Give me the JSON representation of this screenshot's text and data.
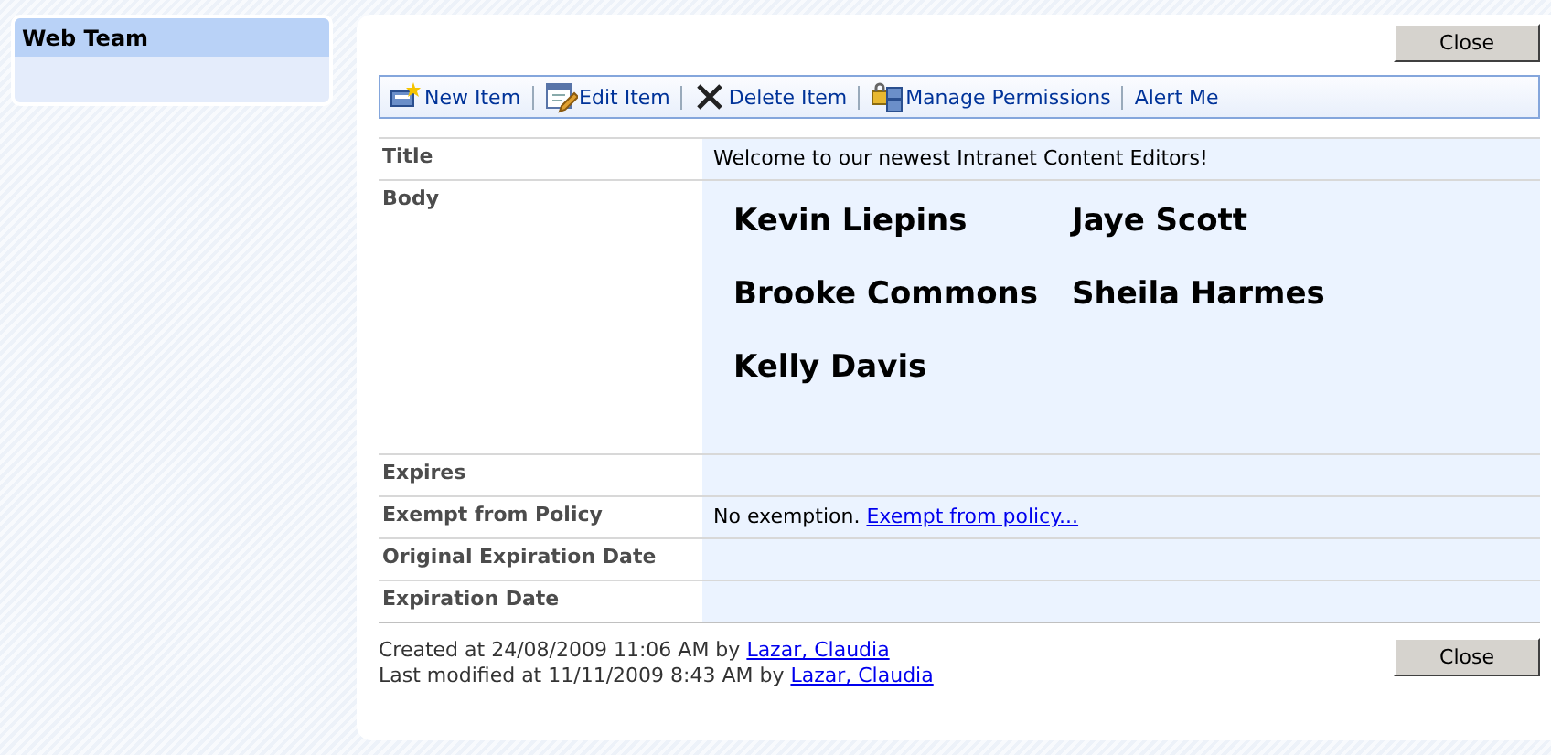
{
  "sidebar": {
    "title": "Web Team"
  },
  "close_buttons": [
    "Close",
    "Close"
  ],
  "toolbar": [
    {
      "kind": "new",
      "label": "New Item"
    },
    {
      "kind": "edit",
      "label": "Edit Item"
    },
    {
      "kind": "delete",
      "label": "Delete Item"
    },
    {
      "kind": "permissions",
      "label": "Manage Permissions"
    },
    {
      "kind": "plain",
      "label": "Alert Me"
    }
  ],
  "fields": [
    {
      "kind": "text",
      "label": "Title",
      "value": "Welcome to our newest Intranet Content Editors!"
    },
    {
      "kind": "names",
      "label": "Body",
      "names": [
        "Kevin Liepins",
        "Jaye Scott",
        "Brooke Commons",
        "Sheila Harmes",
        "Kelly Davis"
      ]
    },
    {
      "kind": "empty",
      "label": "Expires"
    },
    {
      "kind": "link",
      "label": "Exempt from Policy",
      "value": "No exemption.",
      "link": "Exempt from policy..."
    },
    {
      "kind": "empty",
      "label": "Original Expiration Date"
    },
    {
      "kind": "empty",
      "label": "Expiration Date"
    }
  ],
  "footer": [
    {
      "text": "Created at 24/08/2009 11:06 AM  by",
      "link": "Lazar, Claudia"
    },
    {
      "text": "Last modified at 11/11/2009 8:43 AM  by",
      "link": "Lazar, Claudia"
    }
  ]
}
